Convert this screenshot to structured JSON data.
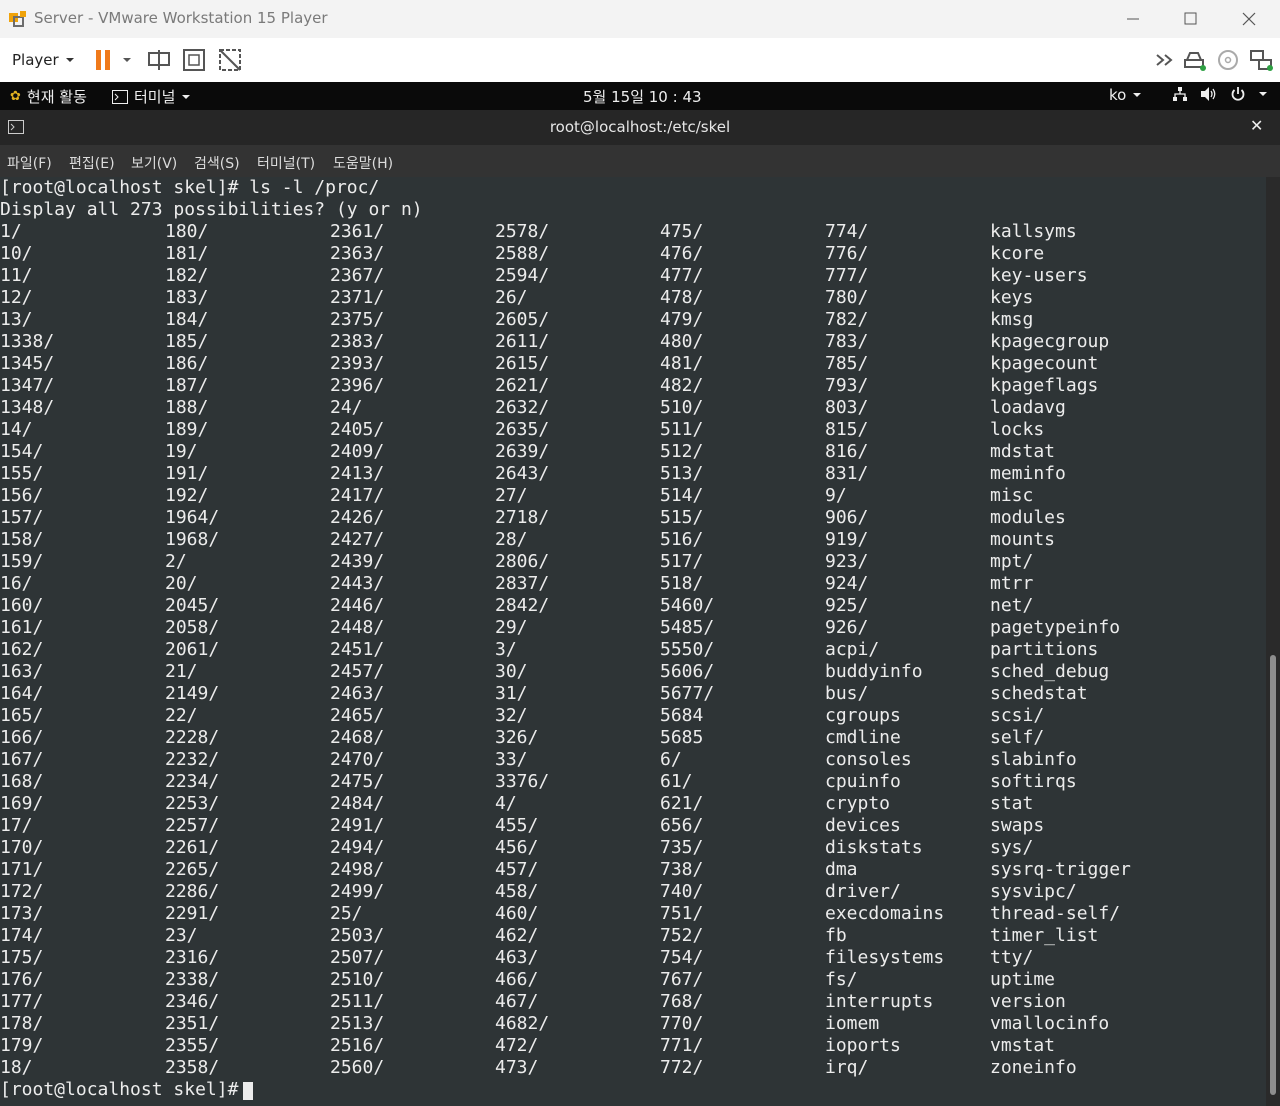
{
  "window": {
    "title": "Server - VMware Workstation 15 Player"
  },
  "toolbar": {
    "player_label": "Player",
    "icons": [
      "pause-icon",
      "send-ctrl-alt-del-icon",
      "fullscreen-icon",
      "unity-icon",
      "forward-icon",
      "removable-drive-icon",
      "cd-icon",
      "network-adapter-icon"
    ]
  },
  "gnome_bar": {
    "activities": "현재 활동",
    "app_menu": "터미널",
    "clock": "5월 15일  10 : 43",
    "language": "ko"
  },
  "terminal": {
    "title": "root@localhost:/etc/skel",
    "menu": [
      "파일(F)",
      "편집(E)",
      "보기(V)",
      "검색(S)",
      "터미널(T)",
      "도움말(H)"
    ],
    "command_line": "[root@localhost skel]# ls -l /proc/",
    "prompt_line": "Display all 273 possibilities? (y or n)",
    "columns": [
      [
        "1/",
        "10/",
        "11/",
        "12/",
        "13/",
        "1338/",
        "1345/",
        "1347/",
        "1348/",
        "14/",
        "154/",
        "155/",
        "156/",
        "157/",
        "158/",
        "159/",
        "16/",
        "160/",
        "161/",
        "162/",
        "163/",
        "164/",
        "165/",
        "166/",
        "167/",
        "168/",
        "169/",
        "17/",
        "170/",
        "171/",
        "172/",
        "173/",
        "174/",
        "175/",
        "176/",
        "177/",
        "178/",
        "179/",
        "18/"
      ],
      [
        "180/",
        "181/",
        "182/",
        "183/",
        "184/",
        "185/",
        "186/",
        "187/",
        "188/",
        "189/",
        "19/",
        "191/",
        "192/",
        "1964/",
        "1968/",
        "2/",
        "20/",
        "2045/",
        "2058/",
        "2061/",
        "21/",
        "2149/",
        "22/",
        "2228/",
        "2232/",
        "2234/",
        "2253/",
        "2257/",
        "2261/",
        "2265/",
        "2286/",
        "2291/",
        "23/",
        "2316/",
        "2338/",
        "2346/",
        "2351/",
        "2355/",
        "2358/"
      ],
      [
        "2361/",
        "2363/",
        "2367/",
        "2371/",
        "2375/",
        "2383/",
        "2393/",
        "2396/",
        "24/",
        "2405/",
        "2409/",
        "2413/",
        "2417/",
        "2426/",
        "2427/",
        "2439/",
        "2443/",
        "2446/",
        "2448/",
        "2451/",
        "2457/",
        "2463/",
        "2465/",
        "2468/",
        "2470/",
        "2475/",
        "2484/",
        "2491/",
        "2494/",
        "2498/",
        "2499/",
        "25/",
        "2503/",
        "2507/",
        "2510/",
        "2511/",
        "2513/",
        "2516/",
        "2560/"
      ],
      [
        "2578/",
        "2588/",
        "2594/",
        "26/",
        "2605/",
        "2611/",
        "2615/",
        "2621/",
        "2632/",
        "2635/",
        "2639/",
        "2643/",
        "27/",
        "2718/",
        "28/",
        "2806/",
        "2837/",
        "2842/",
        "29/",
        "3/",
        "30/",
        "31/",
        "32/",
        "326/",
        "33/",
        "3376/",
        "4/",
        "455/",
        "456/",
        "457/",
        "458/",
        "460/",
        "462/",
        "463/",
        "466/",
        "467/",
        "4682/",
        "472/",
        "473/"
      ],
      [
        "475/",
        "476/",
        "477/",
        "478/",
        "479/",
        "480/",
        "481/",
        "482/",
        "510/",
        "511/",
        "512/",
        "513/",
        "514/",
        "515/",
        "516/",
        "517/",
        "518/",
        "5460/",
        "5485/",
        "5550/",
        "5606/",
        "5677/",
        "5684",
        "5685",
        "6/",
        "61/",
        "621/",
        "656/",
        "735/",
        "738/",
        "740/",
        "751/",
        "752/",
        "754/",
        "767/",
        "768/",
        "770/",
        "771/",
        "772/"
      ],
      [
        "774/",
        "776/",
        "777/",
        "780/",
        "782/",
        "783/",
        "785/",
        "793/",
        "803/",
        "815/",
        "816/",
        "831/",
        "9/",
        "906/",
        "919/",
        "923/",
        "924/",
        "925/",
        "926/",
        "acpi/",
        "buddyinfo",
        "bus/",
        "cgroups",
        "cmdline",
        "consoles",
        "cpuinfo",
        "crypto",
        "devices",
        "diskstats",
        "dma",
        "driver/",
        "execdomains",
        "fb",
        "filesystems",
        "fs/",
        "interrupts",
        "iomem",
        "ioports",
        "irq/"
      ],
      [
        "kallsyms",
        "kcore",
        "key-users",
        "keys",
        "kmsg",
        "kpagecgroup",
        "kpagecount",
        "kpageflags",
        "loadavg",
        "locks",
        "mdstat",
        "meminfo",
        "misc",
        "modules",
        "mounts",
        "mpt/",
        "mtrr",
        "net/",
        "pagetypeinfo",
        "partitions",
        "sched_debug",
        "schedstat",
        "scsi/",
        "self/",
        "slabinfo",
        "softirqs",
        "stat",
        "swaps",
        "sys/",
        "sysrq-trigger",
        "sysvipc/",
        "thread-self/",
        "timer_list",
        "tty/",
        "uptime",
        "version",
        "vmallocinfo",
        "vmstat",
        "zoneinfo"
      ]
    ],
    "final_prompt": "[root@localhost skel]# "
  }
}
